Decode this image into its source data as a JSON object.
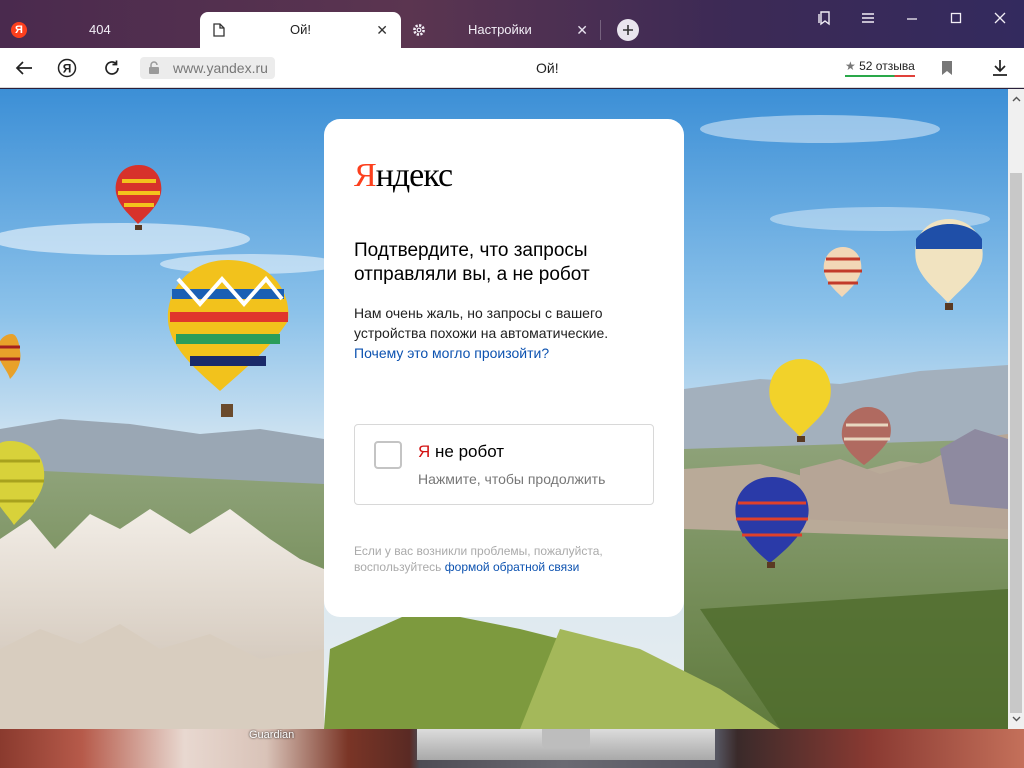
{
  "tabs": [
    {
      "title": "404",
      "favicon": "yandex-logo-icon",
      "active": false
    },
    {
      "title": "Ой!",
      "favicon": "page-icon",
      "active": true
    },
    {
      "title": "Настройки",
      "favicon": "gear-icon",
      "active": false
    }
  ],
  "address_bar": {
    "url": "www.yandex.ru",
    "page_title": "Ой!",
    "reviews": "52 отзыва"
  },
  "captcha_page": {
    "logo_first": "Я",
    "logo_rest": "ндекс",
    "heading": "Подтвердите, что запросы отправляли вы, а не робот",
    "description": "Нам очень жаль, но запросы с вашего устройства похожи на автоматические.",
    "description_link": "Почему это могло произойти?",
    "checkbox_ya": "Я",
    "checkbox_title": "не робот",
    "checkbox_subtitle": "Нажмите, чтобы продолжить",
    "help_text": "Если у вас возникли проблемы, пожалуйста, воспользуйтесь",
    "help_link": "формой обратной связи"
  },
  "taskbar": {
    "label": "Guardian"
  },
  "colors": {
    "yandex_red": "#fc3f1d",
    "link_blue": "#0c52b0",
    "tab_strip": "#4a2a4e"
  }
}
